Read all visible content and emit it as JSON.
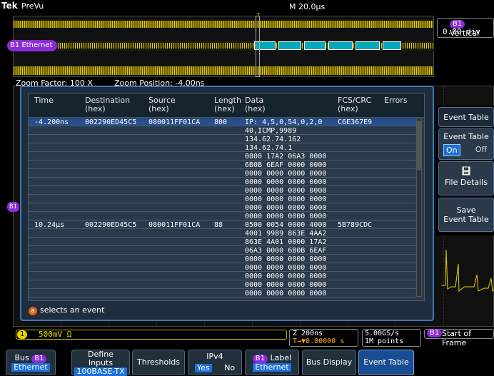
{
  "header": {
    "logo": "Tek",
    "mode": "PreVu",
    "timebase": "M 20.0µs",
    "trigger_marker": "T"
  },
  "overview": {
    "bus_label": "B1",
    "bus_name": "Ethernet"
  },
  "vertical": {
    "chip": "B1",
    "title": "Vertical",
    "value": "0.00 div"
  },
  "zoom": {
    "factor": "Zoom Factor: 100 X",
    "position": "Zoom Position: -4.00ns"
  },
  "left_marker": "B1",
  "event_table": {
    "columns": [
      {
        "line1": "Time",
        "line2": ""
      },
      {
        "line1": "Destination",
        "line2": "(hex)"
      },
      {
        "line1": "Source",
        "line2": "(hex)"
      },
      {
        "line1": "Length",
        "line2": "(hex)"
      },
      {
        "line1": "Data",
        "line2": "(hex)"
      },
      {
        "line1": "FCS/CRC",
        "line2": "(hex)"
      },
      {
        "line1": "Errors",
        "line2": ""
      }
    ],
    "rows": [
      {
        "time": "-4.200ns",
        "dest": "002290ED45C5",
        "src": "080011FF01CA",
        "len": "800",
        "data": "IP: 4,5,0,54,0,2,0",
        "fcs": "C6E367E9",
        "selected": true
      },
      {
        "time": "",
        "dest": "",
        "src": "",
        "len": "",
        "data": "40,ICMP,9989",
        "fcs": ""
      },
      {
        "time": "",
        "dest": "",
        "src": "",
        "len": "",
        "data": "134.62.74.162",
        "fcs": ""
      },
      {
        "time": "",
        "dest": "",
        "src": "",
        "len": "",
        "data": "134.62.74.1",
        "fcs": ""
      },
      {
        "time": "",
        "dest": "",
        "src": "",
        "len": "",
        "data": "0800 17A2 06A3 0000",
        "fcs": ""
      },
      {
        "time": "",
        "dest": "",
        "src": "",
        "len": "",
        "data": "6B0B 6EAF 0000 0000",
        "fcs": ""
      },
      {
        "time": "",
        "dest": "",
        "src": "",
        "len": "",
        "data": "0000 0000 0000 0000",
        "fcs": ""
      },
      {
        "time": "",
        "dest": "",
        "src": "",
        "len": "",
        "data": "0000 0000 0000 0000",
        "fcs": ""
      },
      {
        "time": "",
        "dest": "",
        "src": "",
        "len": "",
        "data": "0000 0000 0000 0000",
        "fcs": ""
      },
      {
        "time": "",
        "dest": "",
        "src": "",
        "len": "",
        "data": "0000 0000 0000 0000",
        "fcs": ""
      },
      {
        "time": "",
        "dest": "",
        "src": "",
        "len": "",
        "data": "0000 0000 0000 0000",
        "fcs": ""
      },
      {
        "time": "",
        "dest": "",
        "src": "",
        "len": "",
        "data": "0000 0000 0000 0000",
        "fcs": ""
      },
      {
        "time": "10.24µs",
        "dest": "002290ED45C5",
        "src": "080011FF01CA",
        "len": "88",
        "data": "0500 0054 0000 4000",
        "fcs": "5B789CDC"
      },
      {
        "time": "",
        "dest": "",
        "src": "",
        "len": "",
        "data": "4001 9989 863E 4AA2",
        "fcs": ""
      },
      {
        "time": "",
        "dest": "",
        "src": "",
        "len": "",
        "data": "863E 4A01 0000 17A2",
        "fcs": ""
      },
      {
        "time": "",
        "dest": "",
        "src": "",
        "len": "",
        "data": "06A3 0000 6B0B 6EAF",
        "fcs": ""
      },
      {
        "time": "",
        "dest": "",
        "src": "",
        "len": "",
        "data": "0000 0000 0000 0000",
        "fcs": ""
      },
      {
        "time": "",
        "dest": "",
        "src": "",
        "len": "",
        "data": "0000 0000 0000 0000",
        "fcs": ""
      },
      {
        "time": "",
        "dest": "",
        "src": "",
        "len": "",
        "data": "0000 0000 0000 0000",
        "fcs": ""
      },
      {
        "time": "",
        "dest": "",
        "src": "",
        "len": "",
        "data": "0000 0000 0000 0000",
        "fcs": ""
      },
      {
        "time": "",
        "dest": "",
        "src": "",
        "len": "",
        "data": "0000 0000 0000 0000",
        "fcs": ""
      }
    ],
    "hint_key": "a",
    "hint": "selects an event"
  },
  "side_menu": {
    "title": "Event Table",
    "toggle_label": "Event Table",
    "on": "On",
    "off": "Off",
    "file_details": "File Details",
    "save_line1": "Save",
    "save_line2": "Event Table"
  },
  "status": {
    "ch1": "1",
    "ch1_scale": "500mV Ω",
    "zoom_scale": "Z 200ns",
    "zoom_trig": "T→▼0.00000 s",
    "rate": "5.00GS/s",
    "points": "1M points",
    "trig_src": "B1",
    "trig_type": "Start of Frame"
  },
  "bottom_menu": {
    "bus_line1": "Bus",
    "bus_chip": "B1",
    "bus_line2": "Ethernet",
    "define_line1": "Define",
    "define_line2": "Inputs",
    "define_line3": "100BASE-TX",
    "thresholds": "Thresholds",
    "ipv4": "IPv4",
    "yes": "Yes",
    "no": "No",
    "label_chip": "B1",
    "label_line1": "Label",
    "label_line2": "Ethernet",
    "bus_display": "Bus Display",
    "event_table": "Event Table"
  }
}
